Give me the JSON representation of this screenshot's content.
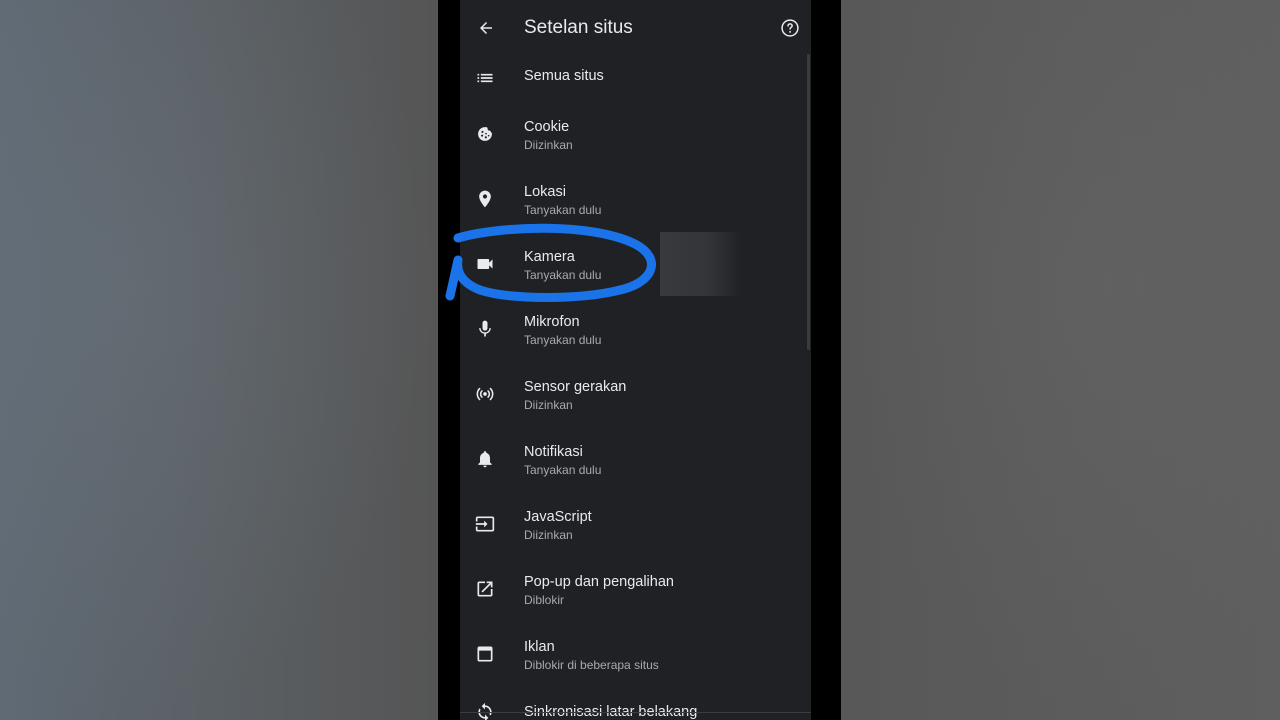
{
  "appbar": {
    "title": "Setelan situs",
    "back_icon": "arrow-back-icon",
    "help_icon": "help-circle-icon"
  },
  "items": [
    {
      "label": "Semua situs",
      "sub": "",
      "icon": "list-icon"
    },
    {
      "label": "Cookie",
      "sub": "Diizinkan",
      "icon": "cookie-icon"
    },
    {
      "label": "Lokasi",
      "sub": "Tanyakan dulu",
      "icon": "location-pin-icon"
    },
    {
      "label": "Kamera",
      "sub": "Tanyakan dulu",
      "icon": "videocam-icon"
    },
    {
      "label": "Mikrofon",
      "sub": "Tanyakan dulu",
      "icon": "mic-icon"
    },
    {
      "label": "Sensor gerakan",
      "sub": "Diizinkan",
      "icon": "sensors-icon"
    },
    {
      "label": "Notifikasi",
      "sub": "Tanyakan dulu",
      "icon": "bell-icon"
    },
    {
      "label": "JavaScript",
      "sub": "Diizinkan",
      "icon": "input-arrow-icon"
    },
    {
      "label": "Pop-up dan pengalihan",
      "sub": "Diblokir",
      "icon": "open-external-icon"
    },
    {
      "label": "Iklan",
      "sub": "Diblokir di beberapa situs",
      "icon": "ad-window-icon"
    },
    {
      "label": "Sinkronisasi latar belakang",
      "sub": "",
      "icon": "sync-icon"
    }
  ],
  "colors": {
    "screen_bg": "#202124",
    "text_primary": "#e8eaed",
    "text_secondary": "#a9aaad",
    "annotation_blue": "#1a73e8"
  }
}
